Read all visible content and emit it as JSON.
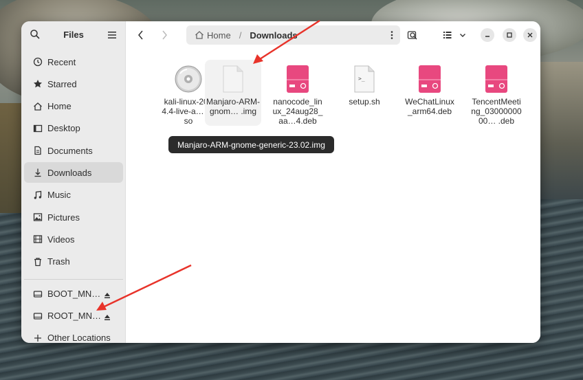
{
  "sidebar": {
    "title": "Files",
    "places": [
      {
        "label": "Recent",
        "icon": "clock-icon"
      },
      {
        "label": "Starred",
        "icon": "star-icon"
      },
      {
        "label": "Home",
        "icon": "home-icon"
      },
      {
        "label": "Desktop",
        "icon": "desktop-icon"
      },
      {
        "label": "Documents",
        "icon": "document-icon"
      },
      {
        "label": "Downloads",
        "icon": "download-icon",
        "active": true
      },
      {
        "label": "Music",
        "icon": "music-icon"
      },
      {
        "label": "Pictures",
        "icon": "picture-icon"
      },
      {
        "label": "Videos",
        "icon": "video-icon"
      },
      {
        "label": "Trash",
        "icon": "trash-icon"
      }
    ],
    "devices": [
      {
        "label": "BOOT_MN…",
        "icon": "drive-icon"
      },
      {
        "label": "ROOT_MN…",
        "icon": "drive-icon"
      }
    ],
    "other": "Other Locations"
  },
  "header": {
    "path_home": "Home",
    "path_sep": "/",
    "path_current": "Downloads"
  },
  "files": [
    {
      "name": "kali-linux-2024.4-live-a… 4.iso",
      "icon": "disc-image-icon"
    },
    {
      "name": "Manjaro-ARM-gnom… .img",
      "icon": "generic-file-icon"
    },
    {
      "name": "nanocode_linux_24aug28_aa…4.deb",
      "icon": "deb-package-icon"
    },
    {
      "name": "setup.sh",
      "icon": "script-icon"
    },
    {
      "name": "WeChatLinux_arm64.deb",
      "icon": "deb-package-icon"
    },
    {
      "name": "TencentMeeting_0300000000… .deb",
      "icon": "deb-package-icon"
    }
  ],
  "tooltip": "Manjaro-ARM-gnome-generic-23.02.img",
  "colors": {
    "accent_deb": "#e8487f",
    "arrow": "#e8332a"
  }
}
